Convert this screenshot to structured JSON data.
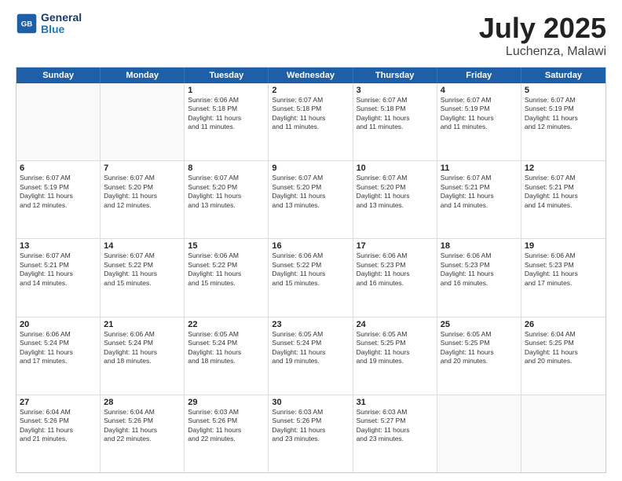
{
  "header": {
    "logo_line1": "General",
    "logo_line2": "Blue",
    "month": "July 2025",
    "location": "Luchenza, Malawi"
  },
  "days_of_week": [
    "Sunday",
    "Monday",
    "Tuesday",
    "Wednesday",
    "Thursday",
    "Friday",
    "Saturday"
  ],
  "weeks": [
    [
      {
        "num": "",
        "info": ""
      },
      {
        "num": "",
        "info": ""
      },
      {
        "num": "1",
        "info": "Sunrise: 6:06 AM\nSunset: 5:18 PM\nDaylight: 11 hours\nand 11 minutes."
      },
      {
        "num": "2",
        "info": "Sunrise: 6:07 AM\nSunset: 5:18 PM\nDaylight: 11 hours\nand 11 minutes."
      },
      {
        "num": "3",
        "info": "Sunrise: 6:07 AM\nSunset: 5:18 PM\nDaylight: 11 hours\nand 11 minutes."
      },
      {
        "num": "4",
        "info": "Sunrise: 6:07 AM\nSunset: 5:19 PM\nDaylight: 11 hours\nand 11 minutes."
      },
      {
        "num": "5",
        "info": "Sunrise: 6:07 AM\nSunset: 5:19 PM\nDaylight: 11 hours\nand 12 minutes."
      }
    ],
    [
      {
        "num": "6",
        "info": "Sunrise: 6:07 AM\nSunset: 5:19 PM\nDaylight: 11 hours\nand 12 minutes."
      },
      {
        "num": "7",
        "info": "Sunrise: 6:07 AM\nSunset: 5:20 PM\nDaylight: 11 hours\nand 12 minutes."
      },
      {
        "num": "8",
        "info": "Sunrise: 6:07 AM\nSunset: 5:20 PM\nDaylight: 11 hours\nand 13 minutes."
      },
      {
        "num": "9",
        "info": "Sunrise: 6:07 AM\nSunset: 5:20 PM\nDaylight: 11 hours\nand 13 minutes."
      },
      {
        "num": "10",
        "info": "Sunrise: 6:07 AM\nSunset: 5:20 PM\nDaylight: 11 hours\nand 13 minutes."
      },
      {
        "num": "11",
        "info": "Sunrise: 6:07 AM\nSunset: 5:21 PM\nDaylight: 11 hours\nand 14 minutes."
      },
      {
        "num": "12",
        "info": "Sunrise: 6:07 AM\nSunset: 5:21 PM\nDaylight: 11 hours\nand 14 minutes."
      }
    ],
    [
      {
        "num": "13",
        "info": "Sunrise: 6:07 AM\nSunset: 5:21 PM\nDaylight: 11 hours\nand 14 minutes."
      },
      {
        "num": "14",
        "info": "Sunrise: 6:07 AM\nSunset: 5:22 PM\nDaylight: 11 hours\nand 15 minutes."
      },
      {
        "num": "15",
        "info": "Sunrise: 6:06 AM\nSunset: 5:22 PM\nDaylight: 11 hours\nand 15 minutes."
      },
      {
        "num": "16",
        "info": "Sunrise: 6:06 AM\nSunset: 5:22 PM\nDaylight: 11 hours\nand 15 minutes."
      },
      {
        "num": "17",
        "info": "Sunrise: 6:06 AM\nSunset: 5:23 PM\nDaylight: 11 hours\nand 16 minutes."
      },
      {
        "num": "18",
        "info": "Sunrise: 6:06 AM\nSunset: 5:23 PM\nDaylight: 11 hours\nand 16 minutes."
      },
      {
        "num": "19",
        "info": "Sunrise: 6:06 AM\nSunset: 5:23 PM\nDaylight: 11 hours\nand 17 minutes."
      }
    ],
    [
      {
        "num": "20",
        "info": "Sunrise: 6:06 AM\nSunset: 5:24 PM\nDaylight: 11 hours\nand 17 minutes."
      },
      {
        "num": "21",
        "info": "Sunrise: 6:06 AM\nSunset: 5:24 PM\nDaylight: 11 hours\nand 18 minutes."
      },
      {
        "num": "22",
        "info": "Sunrise: 6:05 AM\nSunset: 5:24 PM\nDaylight: 11 hours\nand 18 minutes."
      },
      {
        "num": "23",
        "info": "Sunrise: 6:05 AM\nSunset: 5:24 PM\nDaylight: 11 hours\nand 19 minutes."
      },
      {
        "num": "24",
        "info": "Sunrise: 6:05 AM\nSunset: 5:25 PM\nDaylight: 11 hours\nand 19 minutes."
      },
      {
        "num": "25",
        "info": "Sunrise: 6:05 AM\nSunset: 5:25 PM\nDaylight: 11 hours\nand 20 minutes."
      },
      {
        "num": "26",
        "info": "Sunrise: 6:04 AM\nSunset: 5:25 PM\nDaylight: 11 hours\nand 20 minutes."
      }
    ],
    [
      {
        "num": "27",
        "info": "Sunrise: 6:04 AM\nSunset: 5:26 PM\nDaylight: 11 hours\nand 21 minutes."
      },
      {
        "num": "28",
        "info": "Sunrise: 6:04 AM\nSunset: 5:26 PM\nDaylight: 11 hours\nand 22 minutes."
      },
      {
        "num": "29",
        "info": "Sunrise: 6:03 AM\nSunset: 5:26 PM\nDaylight: 11 hours\nand 22 minutes."
      },
      {
        "num": "30",
        "info": "Sunrise: 6:03 AM\nSunset: 5:26 PM\nDaylight: 11 hours\nand 23 minutes."
      },
      {
        "num": "31",
        "info": "Sunrise: 6:03 AM\nSunset: 5:27 PM\nDaylight: 11 hours\nand 23 minutes."
      },
      {
        "num": "",
        "info": ""
      },
      {
        "num": "",
        "info": ""
      }
    ]
  ]
}
